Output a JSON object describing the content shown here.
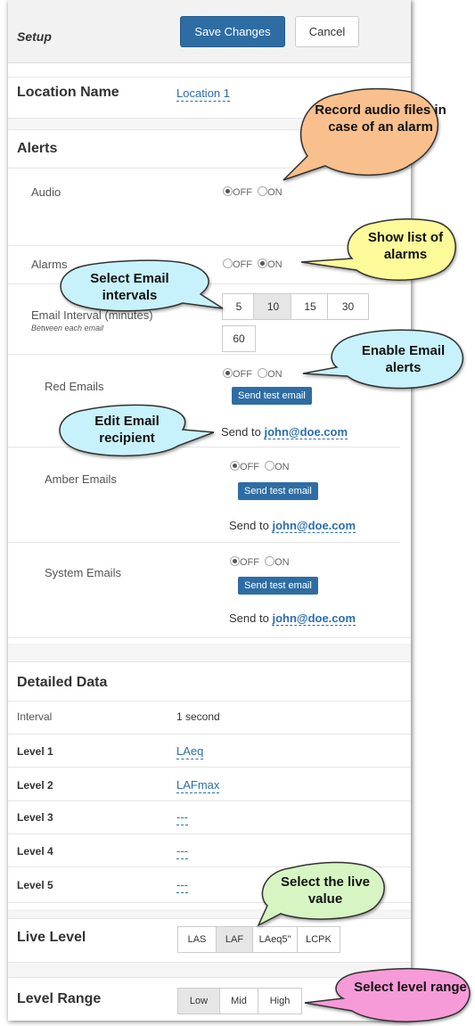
{
  "header": {
    "title": "Setup",
    "save_label": "Save Changes",
    "cancel_label": "Cancel"
  },
  "location": {
    "label": "Location Name",
    "value": "Location 1"
  },
  "alerts": {
    "title": "Alerts",
    "audio": {
      "label": "Audio",
      "off": "OFF",
      "on": "ON",
      "selected": "OFF"
    },
    "alarms": {
      "label": "Alarms",
      "off": "OFF",
      "on": "ON",
      "selected": "ON"
    },
    "email_interval": {
      "label": "Email Interval (minutes)",
      "sublabel": "Between each email",
      "options": [
        "5",
        "10",
        "15",
        "30",
        "60"
      ],
      "selected": "10"
    },
    "red": {
      "label": "Red Emails",
      "off": "OFF",
      "on": "ON",
      "test": "Send test email",
      "send_to_label": "Send to",
      "email": "john@doe.com"
    },
    "amber": {
      "label": "Amber Emails",
      "off": "OFF",
      "on": "ON",
      "test": "Send test email",
      "send_to_label": "Send to",
      "email": "john@doe.com"
    },
    "system": {
      "label": "System Emails",
      "off": "OFF",
      "on": "ON",
      "test": "Send test email",
      "send_to_label": "Send to",
      "email": "john@doe.com"
    }
  },
  "detailed": {
    "title": "Detailed Data",
    "interval_label": "Interval",
    "interval_value": "1 second",
    "levels": [
      {
        "label": "Level 1",
        "value": "LAeq"
      },
      {
        "label": "Level 2",
        "value": "LAFmax"
      },
      {
        "label": "Level 3",
        "value": "---"
      },
      {
        "label": "Level 4",
        "value": "---"
      },
      {
        "label": "Level 5",
        "value": "---"
      }
    ]
  },
  "live": {
    "label": "Live Level",
    "options": [
      "LAS",
      "LAF",
      "LAeq5\"",
      "LCPK"
    ],
    "selected": "LAF"
  },
  "range": {
    "label": "Level Range",
    "options": [
      "Low",
      "Mid",
      "High"
    ],
    "selected": "Low"
  },
  "callouts": {
    "record_audio": "Record audio files in case of an alarm",
    "show_alarms": "Show list of alarms",
    "email_intervals": "Select Email intervals",
    "enable_email": "Enable Email alerts",
    "edit_recipient": "Edit Email recipient",
    "live_value": "Select the live value",
    "level_range": "Select level range"
  },
  "colors": {
    "primary": "#2e6da4",
    "link": "#2a6db0",
    "callout_orange": "#f9c08d",
    "callout_yellow": "#fdfa9a",
    "callout_cyan": "#c8f2fb",
    "callout_green": "#d7f5c3",
    "callout_pink": "#f79ad8"
  }
}
